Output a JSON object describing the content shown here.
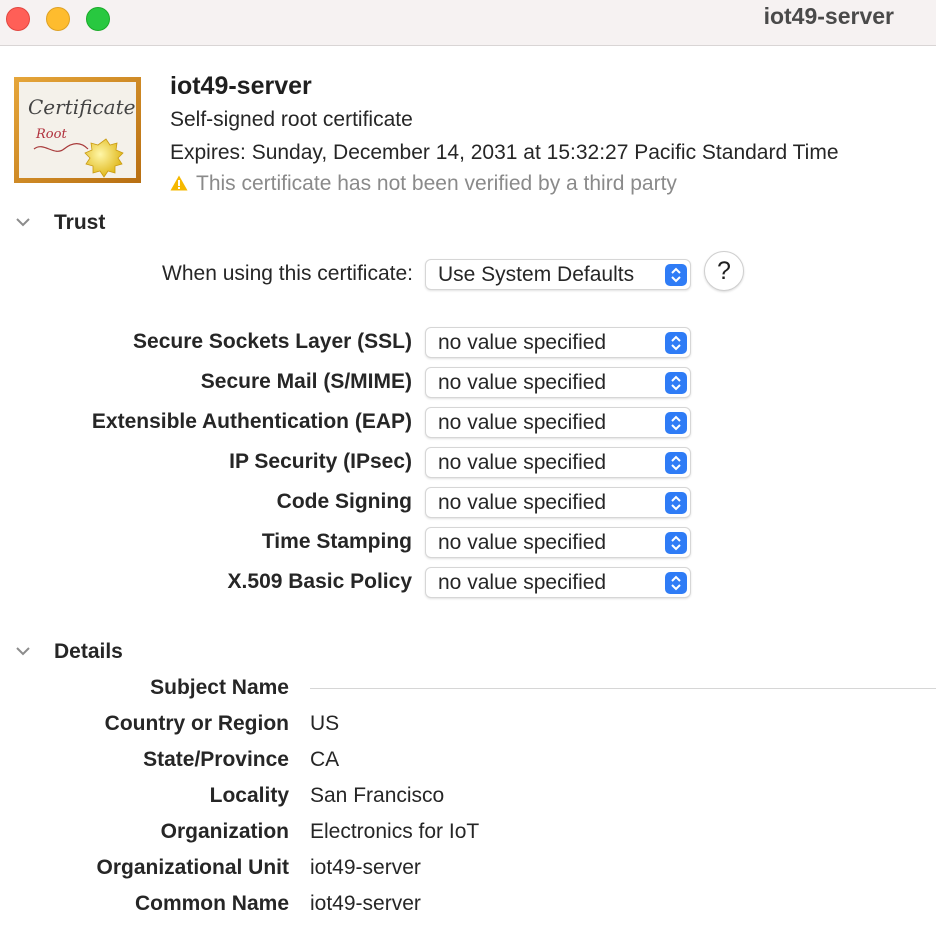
{
  "window": {
    "title": "iot49-server"
  },
  "certificate": {
    "name": "iot49-server",
    "type": "Self-signed root certificate",
    "expires": "Expires: Sunday, December 14, 2031 at 15:32:27 Pacific Standard Time",
    "warning": "This certificate has not been verified by a third party",
    "icon_text": {
      "title": "Certificate",
      "subtitle": "Root"
    }
  },
  "trust": {
    "title": "Trust",
    "when_using_label": "When using this certificate:",
    "when_using_value": "Use System Defaults",
    "help_label": "?",
    "policies": [
      {
        "label": "Secure Sockets Layer (SSL)",
        "value": "no value specified"
      },
      {
        "label": "Secure Mail (S/MIME)",
        "value": "no value specified"
      },
      {
        "label": "Extensible Authentication (EAP)",
        "value": "no value specified"
      },
      {
        "label": "IP Security (IPsec)",
        "value": "no value specified"
      },
      {
        "label": "Code Signing",
        "value": "no value specified"
      },
      {
        "label": "Time Stamping",
        "value": "no value specified"
      },
      {
        "label": "X.509 Basic Policy",
        "value": "no value specified"
      }
    ]
  },
  "details": {
    "title": "Details",
    "subject_name_label": "Subject Name",
    "fields": [
      {
        "label": "Country or Region",
        "value": "US"
      },
      {
        "label": "State/Province",
        "value": "CA"
      },
      {
        "label": "Locality",
        "value": "San Francisco"
      },
      {
        "label": "Organization",
        "value": "Electronics for IoT"
      },
      {
        "label": "Organizational Unit",
        "value": "iot49-server"
      },
      {
        "label": "Common Name",
        "value": "iot49-server"
      }
    ]
  },
  "colors": {
    "accent": "#2f7cf6",
    "close": "#ff5f57",
    "minimize": "#febc2e",
    "zoom": "#28c840",
    "warning": "#f5b800"
  },
  "icons": [
    "close-icon",
    "minimize-icon",
    "zoom-icon",
    "certificate-icon",
    "warning-icon",
    "chevron-down-icon",
    "stepper-icon",
    "help-icon"
  ]
}
